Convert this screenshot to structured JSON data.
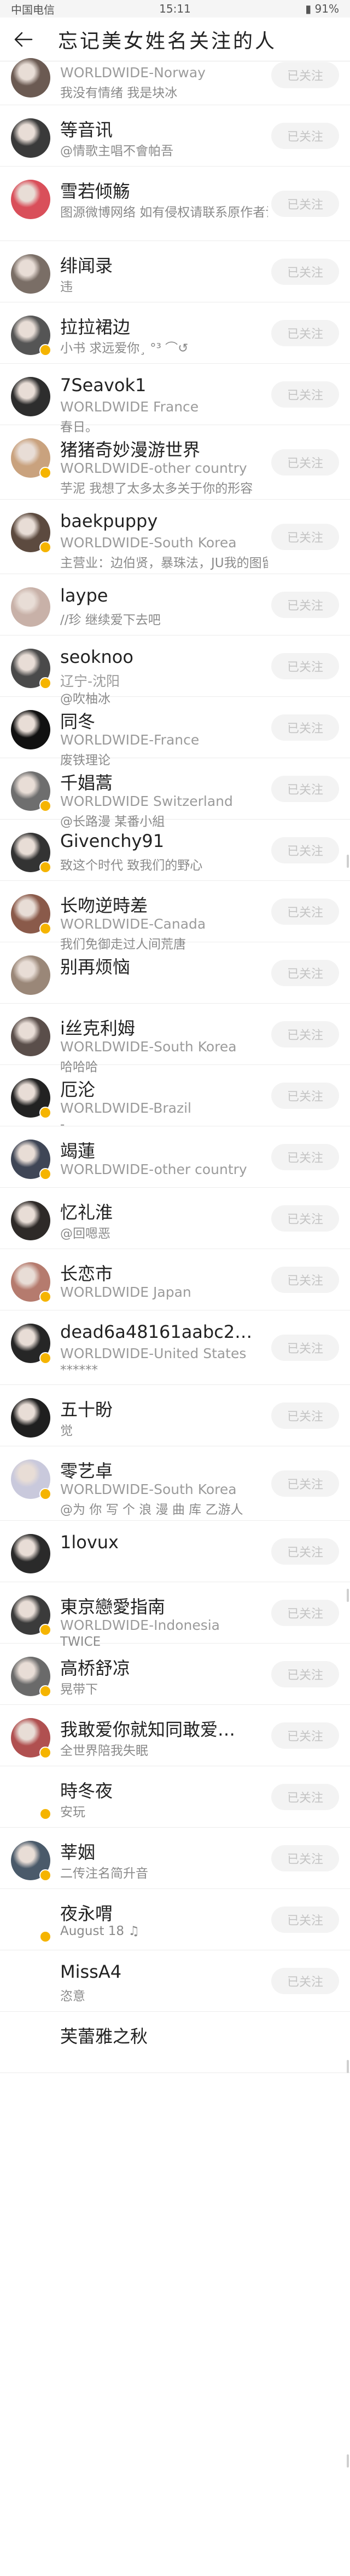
{
  "statusbar": {
    "left": "中国电信",
    "time": "15:11",
    "battery": "91%"
  },
  "header": {
    "title": "忘记美女姓名关注的人"
  },
  "users": [
    {
      "name": "",
      "location": "WORLDWIDE-Norway",
      "bio": "我没有情绪  我是块冰",
      "follow_label": "已关注",
      "avatar_color": "#6b5a52",
      "badge": false
    },
    {
      "name": "等音讯",
      "location": "",
      "bio": "@情歌主唱不會帕吾",
      "follow_label": "已关注",
      "avatar_color": "#3a3a3a",
      "badge": false
    },
    {
      "name": "雪若倾觞",
      "location": "",
      "bio": "图源微博网络 如有侵权请联系原作者让我删除 谢谢",
      "follow_label": "已关注",
      "avatar_color": "#d94f5a",
      "badge": false
    },
    {
      "name": "绯闻录",
      "location": "",
      "bio": "违",
      "follow_label": "已关注",
      "avatar_color": "#7a6e66",
      "badge": false
    },
    {
      "name": "拉拉裙边",
      "location": "",
      "bio": "小书 求远爱你¸ °³ ⌒↺",
      "follow_label": "已关注",
      "avatar_color": "#555555",
      "badge": true
    },
    {
      "name": "7Seavok1",
      "location": "WORLDWIDE France",
      "bio": "春日。",
      "follow_label": "已关注",
      "avatar_color": "#2d2d2d",
      "badge": false
    },
    {
      "name": "猪猪奇妙漫游世界",
      "location": "WORLDWIDE-other country",
      "bio": "芋泥 我想了太多太多关于你的形容",
      "follow_label": "已关注",
      "avatar_color": "#c9a27e",
      "badge": true
    },
    {
      "name": "baekpuppy",
      "location": "WORLDWIDE-South Korea",
      "bio": "主营业：边伯贤，暴珠法，JU我的图留中都一样，严禁…",
      "follow_label": "已关注",
      "avatar_color": "#5c4a3f",
      "badge": true
    },
    {
      "name": "laype",
      "location": "",
      "bio": "//珍 继续爱下去吧",
      "follow_label": "已关注",
      "avatar_color": "#c8b1a8",
      "badge": false
    },
    {
      "name": "seoknoo",
      "location": "辽宁-沈阳",
      "bio": "@吹柚冰",
      "follow_label": "已关注",
      "avatar_color": "#4a4a4a",
      "badge": true
    },
    {
      "name": "同冬",
      "location": "WORLDWIDE-France",
      "bio": "废铁理论",
      "follow_label": "已关注",
      "avatar_color": "#111111",
      "badge": false
    },
    {
      "name": "千娼蒿",
      "location": "WORLDWIDE Switzerland",
      "bio": "@长路漫 某番小組",
      "follow_label": "已关注",
      "avatar_color": "#6e6e6e",
      "badge": true
    },
    {
      "name": "Givenchy91",
      "location": "",
      "bio": "致这个时代 致我们的野心",
      "follow_label": "已关注",
      "avatar_color": "#333333",
      "badge": true
    },
    {
      "name": "长吻逆時差",
      "location": "WORLDWIDE-Canada",
      "bio": "我们免御走过人间荒唐",
      "follow_label": "已关注",
      "avatar_color": "#8a5a4a",
      "badge": true
    },
    {
      "name": "别再烦恼",
      "location": "",
      "bio": "",
      "follow_label": "已关注",
      "avatar_color": "#9a8778",
      "badge": false
    },
    {
      "name": "i丝克利姆",
      "location": "WORLDWIDE-South Korea",
      "bio": "哈哈哈",
      "follow_label": "已关注",
      "avatar_color": "#5a4e4a",
      "badge": false
    },
    {
      "name": "厄沦",
      "location": "WORLDWIDE-Brazil",
      "bio": "-",
      "follow_label": "已关注",
      "avatar_color": "#222222",
      "badge": true
    },
    {
      "name": "竭蓮",
      "location": "WORLDWIDE-other country",
      "bio": "",
      "follow_label": "已关注",
      "avatar_color": "#3f4656",
      "badge": true
    },
    {
      "name": "忆礼淮",
      "location": "",
      "bio": "@回嗯恶",
      "follow_label": "已关注",
      "avatar_color": "#2e2a28",
      "badge": false
    },
    {
      "name": "长恋市",
      "location": "WORLDWIDE Japan",
      "bio": "",
      "follow_label": "已关注",
      "avatar_color": "#b57b6e",
      "badge": true
    },
    {
      "name": "dead6a48161aabc28…",
      "location": "WORLDWIDE-United States",
      "bio": "******",
      "follow_label": "已关注",
      "avatar_color": "#262626",
      "badge": true
    },
    {
      "name": "五十盼",
      "location": "",
      "bio": "觉",
      "follow_label": "已关注",
      "avatar_color": "#1f1f1f",
      "badge": false
    },
    {
      "name": "零艺卓",
      "location": "WORLDWIDE-South Korea",
      "bio": "@为 你 写 个 浪 漫 曲 库 乙游人",
      "follow_label": "已关注",
      "avatar_color": "#c9c9dc",
      "badge": true
    },
    {
      "name": "1lovux",
      "location": "",
      "bio": "",
      "follow_label": "已关注",
      "avatar_color": "#2a2a2a",
      "badge": false
    },
    {
      "name": "東京戀愛指南",
      "location": "WORLDWIDE-Indonesia",
      "bio": "TWICE",
      "follow_label": "已关注",
      "avatar_color": "#3b3b3b",
      "badge": true
    },
    {
      "name": "高桥舒凉",
      "location": "",
      "bio": "晃带下",
      "follow_label": "已关注",
      "avatar_color": "#6a6a6a",
      "badge": true
    },
    {
      "name": "我敢爱你就知同敢爱…",
      "location": "",
      "bio": "全世界陪我失眠",
      "follow_label": "已关注",
      "avatar_color": "#b05050",
      "badge": true
    },
    {
      "name": "時冬夜",
      "location": "",
      "bio": "安玩",
      "follow_label": "已关注",
      "avatar_color": "#ffffff",
      "badge": true
    },
    {
      "name": "莘姻",
      "location": "",
      "bio": "二传注名简升音",
      "follow_label": "已关注",
      "avatar_color": "#4a5a6a",
      "badge": true
    },
    {
      "name": "夜永喟",
      "location": "",
      "bio": "August 18 ♫",
      "follow_label": "已关注",
      "avatar_color": "#ffffff",
      "badge": true
    },
    {
      "name": "MissA4",
      "location": "",
      "bio": "恣意",
      "follow_label": "已关注",
      "avatar_color": "#ffffff",
      "badge": false
    },
    {
      "name": "芙蕾雅之秋",
      "location": "",
      "bio": "",
      "follow_label": "",
      "avatar_color": "#ffffff",
      "badge": false
    }
  ]
}
